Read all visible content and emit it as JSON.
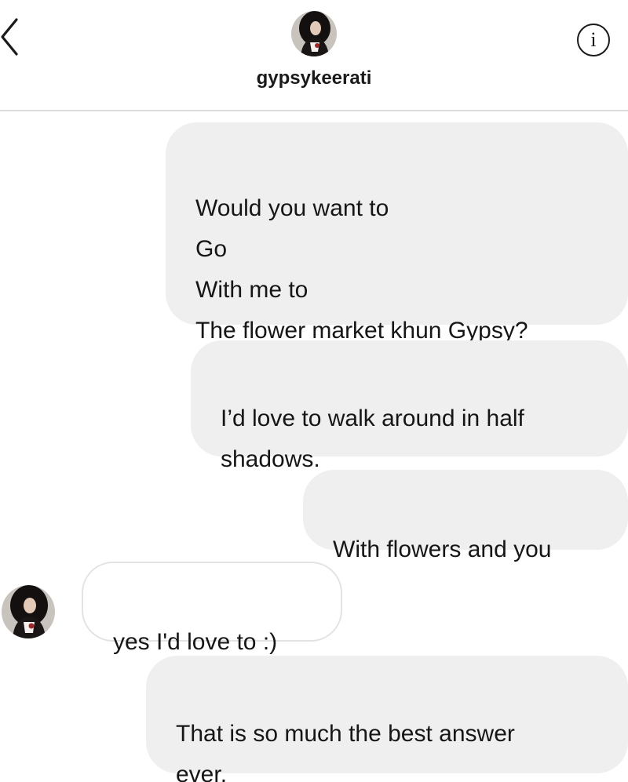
{
  "header": {
    "username": "gypsykeerati"
  },
  "icons": {
    "back": "chevron-left-icon",
    "info": "info-icon",
    "info_glyph": "i"
  },
  "colors": {
    "outgoing_bubble": "#efefef",
    "incoming_bubble": "#ffffff",
    "text": "#161616"
  },
  "messages": [
    {
      "direction": "outgoing",
      "text": "Would you want to\nGo\nWith me to\nThe flower market khun Gypsy?"
    },
    {
      "direction": "outgoing",
      "text": "I’d love to walk around in half\nshadows."
    },
    {
      "direction": "outgoing",
      "text": "With flowers and you"
    },
    {
      "direction": "incoming",
      "text": "yes I'd love to :)"
    },
    {
      "direction": "outgoing",
      "text": "That is so much the best answer\never."
    }
  ]
}
